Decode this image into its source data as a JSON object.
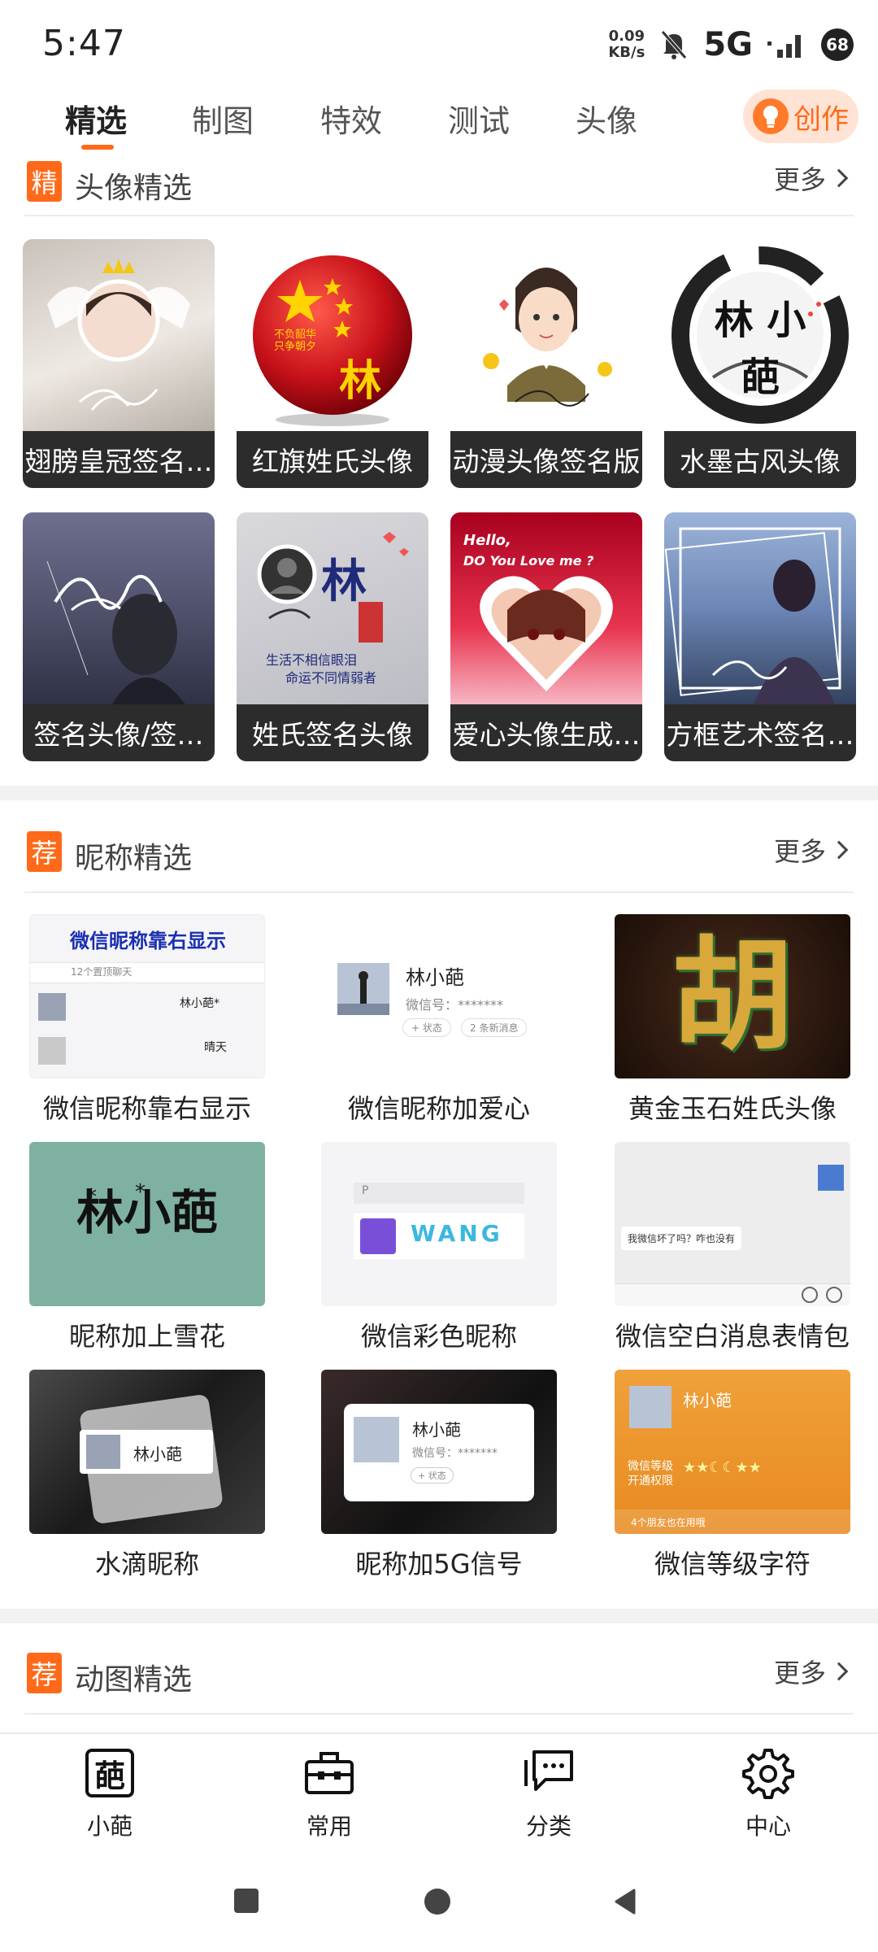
{
  "status": {
    "time": "5:47",
    "speed_value": "0.09",
    "speed_unit": "KB/s",
    "network": "5G",
    "battery": "68"
  },
  "tabs": [
    {
      "label": "精选",
      "active": true
    },
    {
      "label": "制图"
    },
    {
      "label": "特效"
    },
    {
      "label": "测试"
    },
    {
      "label": "头像"
    }
  ],
  "create_button": {
    "label": "创作"
  },
  "sections": {
    "avatar": {
      "badge": "精",
      "title": "头像精选",
      "more": "更多"
    },
    "nickname": {
      "badge": "荐",
      "title": "昵称精选",
      "more": "更多"
    },
    "gif": {
      "badge": "荐",
      "title": "动图精选",
      "more": "更多"
    }
  },
  "avatar_items": [
    {
      "label": "翅膀皇冠签名…"
    },
    {
      "label": "红旗姓氏头像",
      "art_text": "林",
      "side_text": "不负韶华 只争朝夕"
    },
    {
      "label": "动漫头像签名版"
    },
    {
      "label": "水墨古风头像",
      "art_text": "林 小 葩"
    },
    {
      "label": "签名头像/签…"
    },
    {
      "label": "姓氏签名头像",
      "art_text": "林",
      "art_line1": "生活不相信眼泪",
      "art_line2": "命运不同情弱者"
    },
    {
      "label": "爱心头像生成…",
      "art_line1": "Hello,",
      "art_line2": "DO You Love me ?"
    },
    {
      "label": "方框艺术签名…"
    }
  ],
  "nickname_items": [
    {
      "label": "微信昵称靠右显示",
      "art_title": "微信昵称靠右显示",
      "art_sub": "12个置顶聊天",
      "art_name1": "林小葩*",
      "art_name2": "晴天"
    },
    {
      "label": "微信昵称加爱心",
      "art_name": "林小葩",
      "art_id": "微信号：*******",
      "art_status": "+ 状态",
      "art_friends": "2 条新消息"
    },
    {
      "label": "黄金玉石姓氏头像",
      "art_text": "胡"
    },
    {
      "label": "昵称加上雪花",
      "art_text": "林小葩"
    },
    {
      "label": "微信彩色昵称",
      "art_text": "WANG",
      "art_letter": "P"
    },
    {
      "label": "微信空白消息表情包",
      "art_bubble": "我微信坏了吗？咋也没有"
    },
    {
      "label": "水滴昵称",
      "art_name": "林小葩"
    },
    {
      "label": "昵称加5G信号",
      "art_name": "林小葩",
      "art_id": "微信号：*******",
      "art_status": "+ 状态"
    },
    {
      "label": "微信等级字符",
      "art_name": "林小葩",
      "art_line": "微信等级 开通权限",
      "art_foot": "4个朋友也在用哦"
    }
  ],
  "bottom_nav": [
    {
      "label": "小葩",
      "icon": "pa-logo-icon",
      "glyph": "葩"
    },
    {
      "label": "常用",
      "icon": "toolbox-icon"
    },
    {
      "label": "分类",
      "icon": "chat-bubble-icon"
    },
    {
      "label": "中心",
      "icon": "gear-icon"
    }
  ],
  "colors": {
    "accent": "#ff6a1a",
    "caption_bg": "#2c2c2c"
  }
}
